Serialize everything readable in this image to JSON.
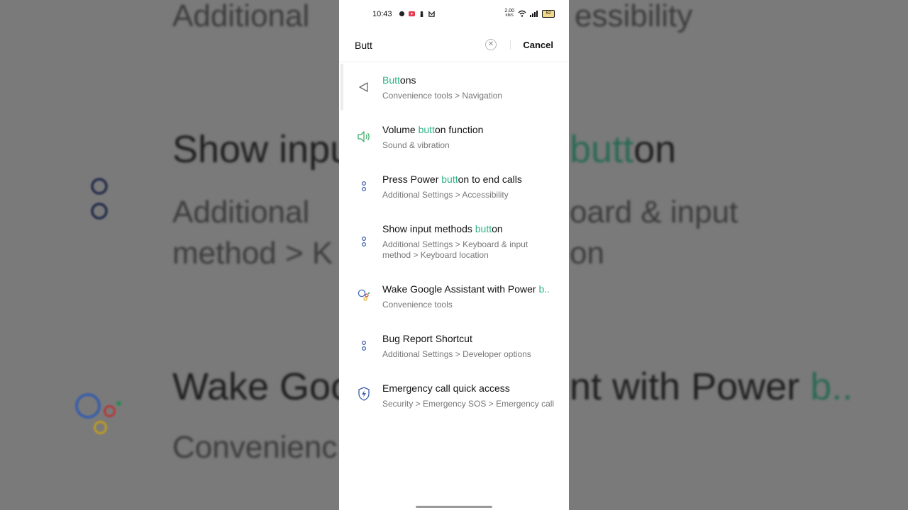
{
  "backdrop": {
    "line1": "Additional",
    "line1b": "essibility",
    "line2a": "Show inpu",
    "line2b_hl": "butt",
    "line2c": "on",
    "line3a": "Additional",
    "line3b": "oard & input",
    "line4a": "method > K",
    "line4b": "on",
    "line5a": "Wake Goo",
    "line5b": "nt with Power",
    "line5c": "b..",
    "line6a": "Convenienc"
  },
  "status_bar": {
    "time": "10:43",
    "net_speed_top": "2.00",
    "net_speed_bottom": "KB/S",
    "battery": "52"
  },
  "search": {
    "query": "Butt",
    "cancel_label": "Cancel"
  },
  "results": [
    {
      "title_hl": "Butt",
      "title_rest": "ons",
      "title_pre": "",
      "subtitle": "Convenience tools > Navigation",
      "icon": "navigation-icon"
    },
    {
      "title_pre": "Volume ",
      "title_hl": "butt",
      "title_rest": "on function",
      "subtitle": "Sound & vibration",
      "icon": "speaker-icon"
    },
    {
      "title_pre": "Press Power ",
      "title_hl": "butt",
      "title_rest": "on to end calls",
      "subtitle": "Additional Settings > Accessibility",
      "icon": "settings-dots-icon"
    },
    {
      "title_pre": "Show input methods ",
      "title_hl": "butt",
      "title_rest": "on",
      "subtitle": "Additional Settings > Keyboard & input method > Keyboard location",
      "icon": "settings-dots-icon"
    },
    {
      "title_pre": "Wake Google Assistant with Power ",
      "title_hl": "b..",
      "title_rest": "",
      "subtitle": "Convenience tools",
      "icon": "google-assistant-icon"
    },
    {
      "title_pre": "Bug Report Shortcut",
      "title_hl": "",
      "title_rest": "",
      "subtitle": "Additional Settings > Developer options",
      "icon": "settings-dots-icon"
    },
    {
      "title_pre": "Emergency call quick access",
      "title_hl": "",
      "title_rest": "",
      "subtitle": "Security > Emergency SOS > Emergency call",
      "icon": "emergency-shield-icon"
    }
  ],
  "colors": {
    "highlight": "#2fb485",
    "icon_blue": "#3d5fa8",
    "speaker_green": "#3fb06b"
  }
}
